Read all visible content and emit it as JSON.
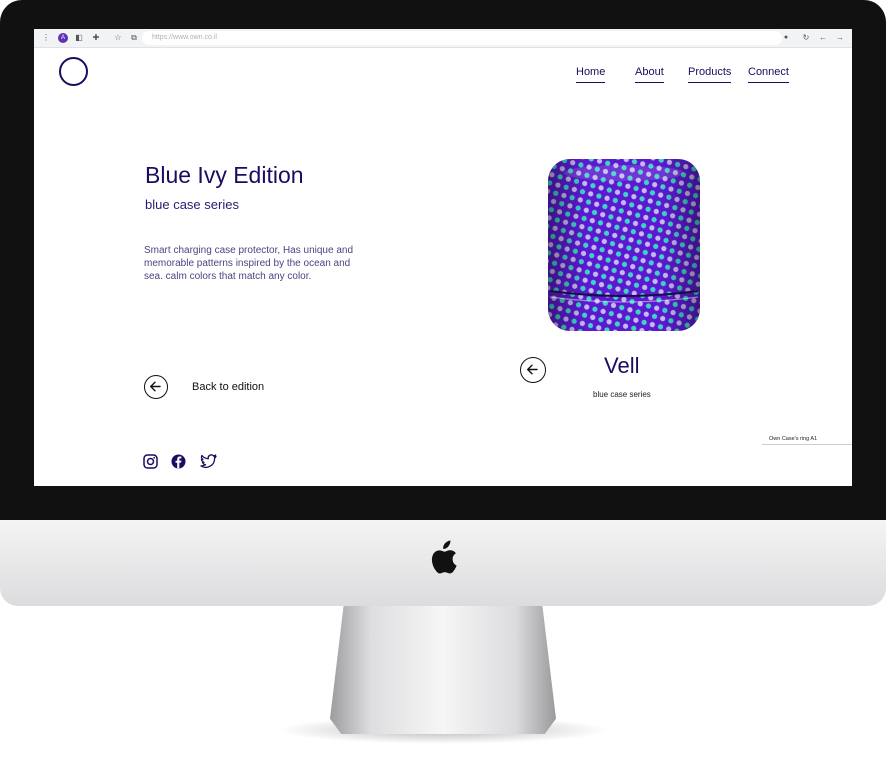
{
  "browser": {
    "url": "https://www.own.co.il",
    "profile_initial": "A"
  },
  "nav": {
    "items": [
      {
        "label": "Home"
      },
      {
        "label": "About"
      },
      {
        "label": "Products"
      },
      {
        "label": "Connect"
      }
    ]
  },
  "hero": {
    "title": "Blue Ivy Edition",
    "subtitle": "blue case series",
    "description": "Smart charging case protector, Has unique and memorable patterns inspired by the ocean and sea. calm colors that match any color.",
    "back_label": "Back to edition"
  },
  "product": {
    "name": "Vell",
    "series": "blue case series",
    "caption": "Own Case's ring A1"
  },
  "social": [
    "instagram-icon",
    "facebook-icon",
    "twitter-icon"
  ],
  "colors": {
    "brand": "#1e0a5e",
    "case_base": "#5a1bd0",
    "dot_teal": "#3fd3c4",
    "dot_lilac": "#c8b8f0"
  }
}
